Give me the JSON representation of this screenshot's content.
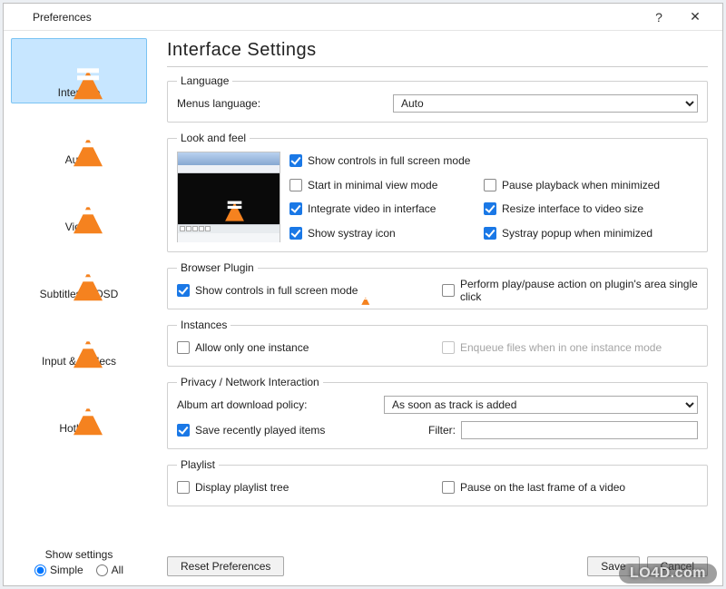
{
  "window": {
    "title": "Preferences"
  },
  "sidebar": {
    "items": [
      {
        "label": "Interface"
      },
      {
        "label": "Audio"
      },
      {
        "label": "Video"
      },
      {
        "label": "Subtitles & OSD"
      },
      {
        "label": "Input & Codecs"
      },
      {
        "label": "Hotkeys"
      }
    ],
    "show_settings_title": "Show settings",
    "radio_simple": "Simple",
    "radio_all": "All"
  },
  "main": {
    "heading": "Interface Settings",
    "language": {
      "legend": "Language",
      "menus_label": "Menus language:",
      "menus_value": "Auto"
    },
    "lookfeel": {
      "legend": "Look and feel",
      "show_controls": "Show controls in full screen mode",
      "start_minimal": "Start in minimal view mode",
      "integrate_video": "Integrate video in interface",
      "show_systray": "Show systray icon",
      "pause_minimized": "Pause playback when minimized",
      "resize_interface": "Resize interface to video size",
      "systray_popup": "Systray popup when minimized"
    },
    "browser": {
      "legend": "Browser Plugin",
      "show_controls": "Show controls in full screen mode",
      "single_click": "Perform play/pause action on plugin's area single click"
    },
    "instances": {
      "legend": "Instances",
      "allow_one": "Allow only one instance",
      "enqueue": "Enqueue files when in one instance mode"
    },
    "privacy": {
      "legend": "Privacy / Network Interaction",
      "album_label": "Album art download policy:",
      "album_value": "As soon as track is added",
      "save_recent": "Save recently played items",
      "filter_label": "Filter:",
      "filter_value": ""
    },
    "playlist": {
      "legend": "Playlist",
      "display_tree": "Display playlist tree",
      "pause_last": "Pause on the last frame of a video"
    }
  },
  "footer": {
    "reset": "Reset Preferences",
    "save": "Save",
    "cancel": "Cancel"
  },
  "watermark": "LO4D.com"
}
